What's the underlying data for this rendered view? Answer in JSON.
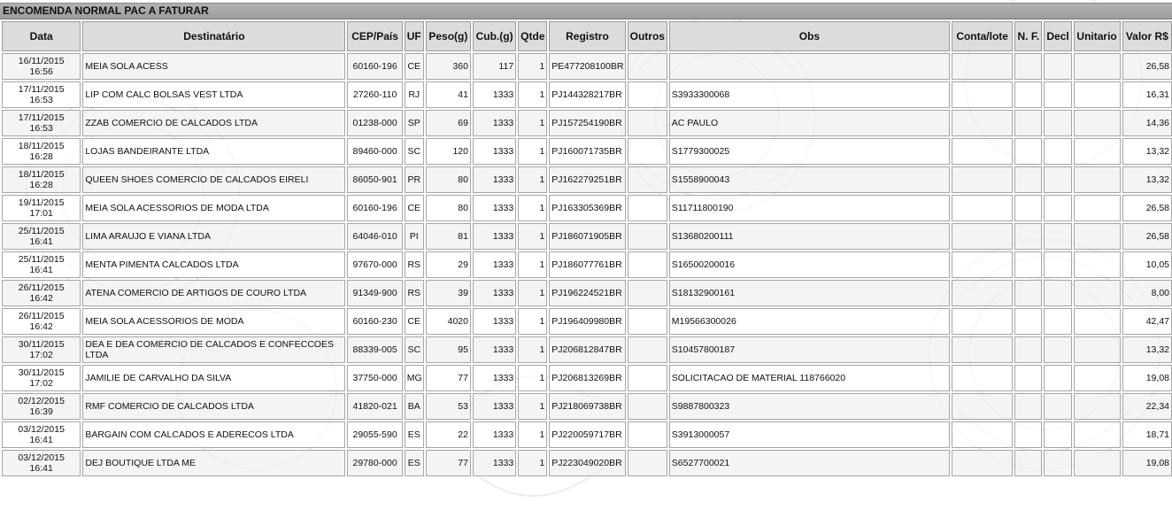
{
  "section_title": "ENCOMENDA NORMAL PAC A FATURAR",
  "columns": [
    "Data",
    "Destinatário",
    "CEP/País",
    "UF",
    "Peso(g)",
    "Cub.(g)",
    "Qtde",
    "Registro",
    "Outros",
    "Obs",
    "Conta/lote",
    "N. F.",
    "Decl",
    "Unitario",
    "Valor R$"
  ],
  "rows": [
    {
      "date": "16/11/2015",
      "time": "16:56",
      "dest": "MEIA SOLA ACESS",
      "cep": "60160-196",
      "uf": "CE",
      "peso": "360",
      "cub": "117",
      "qtde": "1",
      "registro": "PE477208100BR",
      "outros": "",
      "obs": "",
      "conta": "",
      "nf": "",
      "decl": "",
      "unitario": "",
      "valor": "26,58"
    },
    {
      "date": "17/11/2015",
      "time": "16:53",
      "dest": "LIP COM CALC BOLSAS VEST LTDA",
      "cep": "27260-110",
      "uf": "RJ",
      "peso": "41",
      "cub": "1333",
      "qtde": "1",
      "registro": "PJ144328217BR",
      "outros": "",
      "obs": "S3933300068",
      "conta": "",
      "nf": "",
      "decl": "",
      "unitario": "",
      "valor": "16,31"
    },
    {
      "date": "17/11/2015",
      "time": "16:53",
      "dest": "ZZAB COMERCIO DE CALCADOS LTDA",
      "cep": "01238-000",
      "uf": "SP",
      "peso": "69",
      "cub": "1333",
      "qtde": "1",
      "registro": "PJ157254190BR",
      "outros": "",
      "obs": "AC PAULO",
      "conta": "",
      "nf": "",
      "decl": "",
      "unitario": "",
      "valor": "14,36"
    },
    {
      "date": "18/11/2015",
      "time": "16:28",
      "dest": "LOJAS BANDEIRANTE LTDA",
      "cep": "89460-000",
      "uf": "SC",
      "peso": "120",
      "cub": "1333",
      "qtde": "1",
      "registro": "PJ160071735BR",
      "outros": "",
      "obs": "S1779300025",
      "conta": "",
      "nf": "",
      "decl": "",
      "unitario": "",
      "valor": "13,32"
    },
    {
      "date": "18/11/2015",
      "time": "16:28",
      "dest": "QUEEN SHOES COMERCIO DE CALCADOS EIRELI",
      "cep": "86050-901",
      "uf": "PR",
      "peso": "80",
      "cub": "1333",
      "qtde": "1",
      "registro": "PJ162279251BR",
      "outros": "",
      "obs": "S1558900043",
      "conta": "",
      "nf": "",
      "decl": "",
      "unitario": "",
      "valor": "13,32"
    },
    {
      "date": "19/11/2015",
      "time": "17:01",
      "dest": "MEIA SOLA ACESSORIOS DE MODA LTDA",
      "cep": "60160-196",
      "uf": "CE",
      "peso": "80",
      "cub": "1333",
      "qtde": "1",
      "registro": "PJ163305369BR",
      "outros": "",
      "obs": "S11711800190",
      "conta": "",
      "nf": "",
      "decl": "",
      "unitario": "",
      "valor": "26,58"
    },
    {
      "date": "25/11/2015",
      "time": "16:41",
      "dest": "LIMA ARAUJO E VIANA LTDA",
      "cep": "64046-010",
      "uf": "PI",
      "peso": "81",
      "cub": "1333",
      "qtde": "1",
      "registro": "PJ186071905BR",
      "outros": "",
      "obs": "S13680200111",
      "conta": "",
      "nf": "",
      "decl": "",
      "unitario": "",
      "valor": "26,58"
    },
    {
      "date": "25/11/2015",
      "time": "16:41",
      "dest": "MENTA PIMENTA CALCADOS LTDA",
      "cep": "97670-000",
      "uf": "RS",
      "peso": "29",
      "cub": "1333",
      "qtde": "1",
      "registro": "PJ186077761BR",
      "outros": "",
      "obs": "S16500200016",
      "conta": "",
      "nf": "",
      "decl": "",
      "unitario": "",
      "valor": "10,05"
    },
    {
      "date": "26/11/2015",
      "time": "16:42",
      "dest": "ATENA COMERCIO DE ARTIGOS DE COURO LTDA",
      "cep": "91349-900",
      "uf": "RS",
      "peso": "39",
      "cub": "1333",
      "qtde": "1",
      "registro": "PJ196224521BR",
      "outros": "",
      "obs": "S18132900161",
      "conta": "",
      "nf": "",
      "decl": "",
      "unitario": "",
      "valor": "8,00"
    },
    {
      "date": "26/11/2015",
      "time": "16:42",
      "dest": "MEIA SOLA ACESSORIOS DE MODA",
      "cep": "60160-230",
      "uf": "CE",
      "peso": "4020",
      "cub": "1333",
      "qtde": "1",
      "registro": "PJ196409980BR",
      "outros": "",
      "obs": "M19566300026",
      "conta": "",
      "nf": "",
      "decl": "",
      "unitario": "",
      "valor": "42,47"
    },
    {
      "date": "30/11/2015",
      "time": "17:02",
      "dest": "DEA E DEA COMERCIO DE CALCADOS E CONFECCOES LTDA",
      "cep": "88339-005",
      "uf": "SC",
      "peso": "95",
      "cub": "1333",
      "qtde": "1",
      "registro": "PJ206812847BR",
      "outros": "",
      "obs": "S10457800187",
      "conta": "",
      "nf": "",
      "decl": "",
      "unitario": "",
      "valor": "13,32"
    },
    {
      "date": "30/11/2015",
      "time": "17:02",
      "dest": "JAMILIE DE CARVALHO DA SILVA",
      "cep": "37750-000",
      "uf": "MG",
      "peso": "77",
      "cub": "1333",
      "qtde": "1",
      "registro": "PJ206813269BR",
      "outros": "",
      "obs": "SOLICITACAO DE MATERIAL 118766020",
      "conta": "",
      "nf": "",
      "decl": "",
      "unitario": "",
      "valor": "19,08"
    },
    {
      "date": "02/12/2015",
      "time": "16:39",
      "dest": "RMF COMERCIO DE CALCADOS LTDA",
      "cep": "41820-021",
      "uf": "BA",
      "peso": "53",
      "cub": "1333",
      "qtde": "1",
      "registro": "PJ218069738BR",
      "outros": "",
      "obs": "S9887800323",
      "conta": "",
      "nf": "",
      "decl": "",
      "unitario": "",
      "valor": "22,34"
    },
    {
      "date": "03/12/2015",
      "time": "16:41",
      "dest": "BARGAIN COM CALCADOS E ADERECOS LTDA",
      "cep": "29055-590",
      "uf": "ES",
      "peso": "22",
      "cub": "1333",
      "qtde": "1",
      "registro": "PJ220059717BR",
      "outros": "",
      "obs": "S3913000057",
      "conta": "",
      "nf": "",
      "decl": "",
      "unitario": "",
      "valor": "18,71"
    },
    {
      "date": "03/12/2015",
      "time": "16:41",
      "dest": "DEJ BOUTIQUE LTDA ME",
      "cep": "29780-000",
      "uf": "ES",
      "peso": "77",
      "cub": "1333",
      "qtde": "1",
      "registro": "PJ223049020BR",
      "outros": "",
      "obs": "S6527700021",
      "conta": "",
      "nf": "",
      "decl": "",
      "unitario": "",
      "valor": "19,08"
    }
  ]
}
